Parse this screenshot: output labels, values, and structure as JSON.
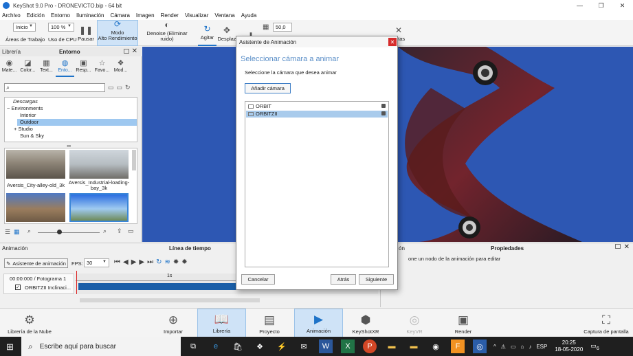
{
  "window": {
    "title": "KeyShot 9.0 Pro  -  DRONEVICTO.bip  -  64 bit",
    "controls": [
      "—",
      "❐",
      "✕"
    ]
  },
  "menu": [
    "Archivo",
    "Edición",
    "Entorno",
    "Iluminación",
    "Cámara",
    "Imagen",
    "Render",
    "Visualizar",
    "Ventana",
    "Ayuda"
  ],
  "toolbar": {
    "workspace_value": "Inicio",
    "workspace_label": "Áreas de Trabajo",
    "cpu_value": "100 %",
    "cpu_label": "Uso de CPU",
    "pause_label": "Pausar",
    "perf_mode_line1": "Modo",
    "perf_mode_line2": "Alto Rendimiento",
    "denoise_label": "Denoise (Eliminar ruido)",
    "shake_label": "Agitar",
    "move_label": "Desplaz",
    "value_field": "50,0",
    "tools_label": "entas"
  },
  "library": {
    "title": "Librería",
    "section": "Entorno",
    "tabs": [
      "Mate...",
      "Color...",
      "Text...",
      "Ento...",
      "Resp...",
      "Favo...",
      "Mod..."
    ],
    "search_placeholder": "",
    "tree": [
      "Descargas",
      "Environments",
      "Interior",
      "Outdoor",
      "Studio",
      "Sun & Sky"
    ],
    "thumbs": [
      {
        "caption": "Aversis_City-alley-old_3k"
      },
      {
        "caption": "Aversis_Industrial-loading-bay_3k"
      },
      {
        "caption": ""
      },
      {
        "caption": ""
      }
    ]
  },
  "animation": {
    "title": "Animación",
    "timeline_title": "Línea de tiempo",
    "wizard_button": "Asistente de animación",
    "fps_label": "FPS:",
    "fps_value": "30",
    "timecode": "00:00:000 / Fotograma 1",
    "track": "ORBITZII Inclinaci...",
    "ruler_mark": "1s"
  },
  "properties": {
    "title": "Propiedades",
    "left_fragment": "ón",
    "hint": "one un nodo de la animación para editar"
  },
  "bottombar": {
    "items": [
      "Librería de la Nube",
      "Importar",
      "Librería",
      "Proyecto",
      "Animación",
      "KeyShotXR",
      "KeyVR",
      "Render",
      "Captura de pantalla"
    ]
  },
  "dialog": {
    "title": "Asistente de Animación",
    "heading": "Seleccionar cámara a animar",
    "subtitle": "Seleccione la cámara que desea animar",
    "add_camera": "Añadir cámara",
    "cameras": [
      "ORBIT",
      "ORBITZII"
    ],
    "selected_camera": "ORBITZII",
    "cancel": "Cancelar",
    "back": "Atrás",
    "next": "Siguiente"
  },
  "taskbar": {
    "search_placeholder": "Escribe aquí para buscar",
    "language": "ESP",
    "time": "20:25",
    "date": "18-05-2020",
    "notifications": "6"
  },
  "colors": {
    "viewport_bg": "#2d57b3",
    "accent": "#1e73c8",
    "dialog_heading": "#5b8fc8",
    "close_red": "#d62c2c",
    "taskbar": "#1f1f1f"
  }
}
